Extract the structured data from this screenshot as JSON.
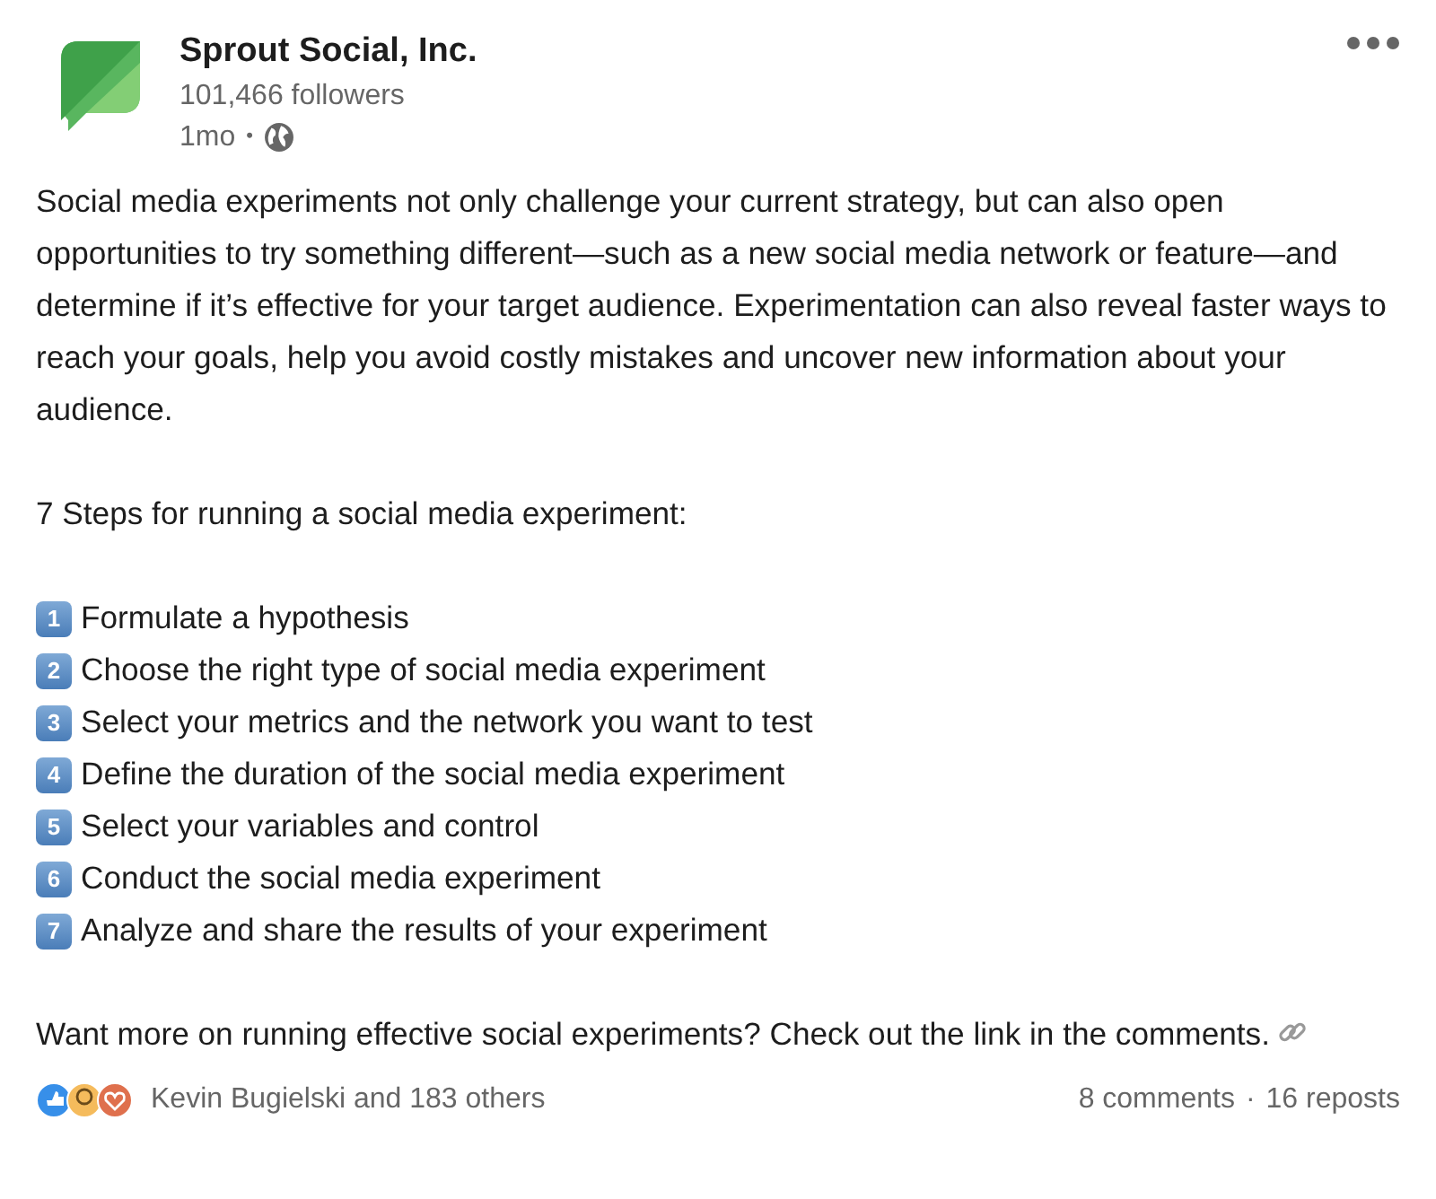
{
  "author": {
    "name": "Sprout Social, Inc.",
    "followers": "101,466 followers",
    "time": "1mo",
    "separator": "•"
  },
  "post": {
    "intro": "Social media experiments not only challenge your current strategy, but can also open opportunities to try something different—such as a new social media network or feature—and determine if it’s effective for your target audience. Experimentation can also reveal faster ways to reach your goals, help you avoid costly mistakes and uncover new information about your audience.",
    "steps_heading": "7 Steps for running a social media experiment:",
    "steps": [
      {
        "number": "1",
        "text": "Formulate a hypothesis"
      },
      {
        "number": "2",
        "text": "Choose the right type of social media experiment"
      },
      {
        "number": "3",
        "text": "Select your metrics and the network you want to test"
      },
      {
        "number": "4",
        "text": "Define the duration of the social media experiment"
      },
      {
        "number": "5",
        "text": "Select your variables and control"
      },
      {
        "number": "6",
        "text": "Conduct the social media experiment"
      },
      {
        "number": "7",
        "text": "Analyze and share the results of your experiment"
      }
    ],
    "closing": "Want more on running effective social experiments? Check out the link in the comments."
  },
  "footer": {
    "reactions": "Kevin Bugielski and 183 others",
    "comments": "8 comments",
    "separator": "·",
    "reposts": "16 reposts"
  }
}
